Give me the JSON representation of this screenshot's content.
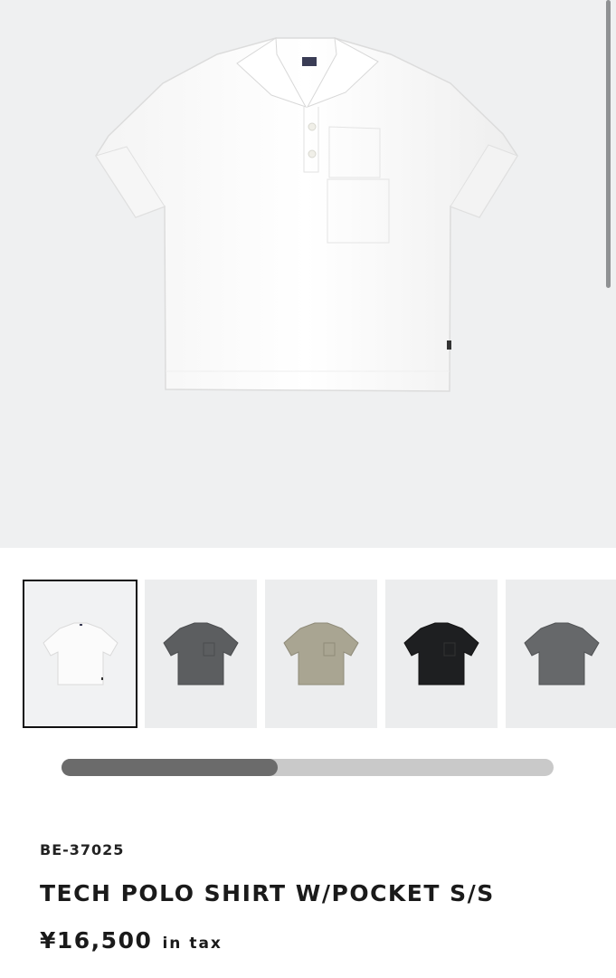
{
  "product": {
    "sku": "BE-37025",
    "name": "TECH POLO SHIRT W/POCKET S/S",
    "price": "¥16,500",
    "tax_note": "in tax"
  },
  "gallery": {
    "main_color": "white",
    "thumbnails": [
      {
        "color": "white",
        "fill": "#fafafa",
        "selected": true
      },
      {
        "color": "charcoal",
        "fill": "#5c5e60",
        "selected": false
      },
      {
        "color": "khaki",
        "fill": "#a9a592",
        "selected": false
      },
      {
        "color": "black",
        "fill": "#1e1f21",
        "selected": false
      },
      {
        "color": "charcoal-back",
        "fill": "#66686a",
        "selected": false
      }
    ],
    "scroll_progress_fraction": 0.44
  }
}
